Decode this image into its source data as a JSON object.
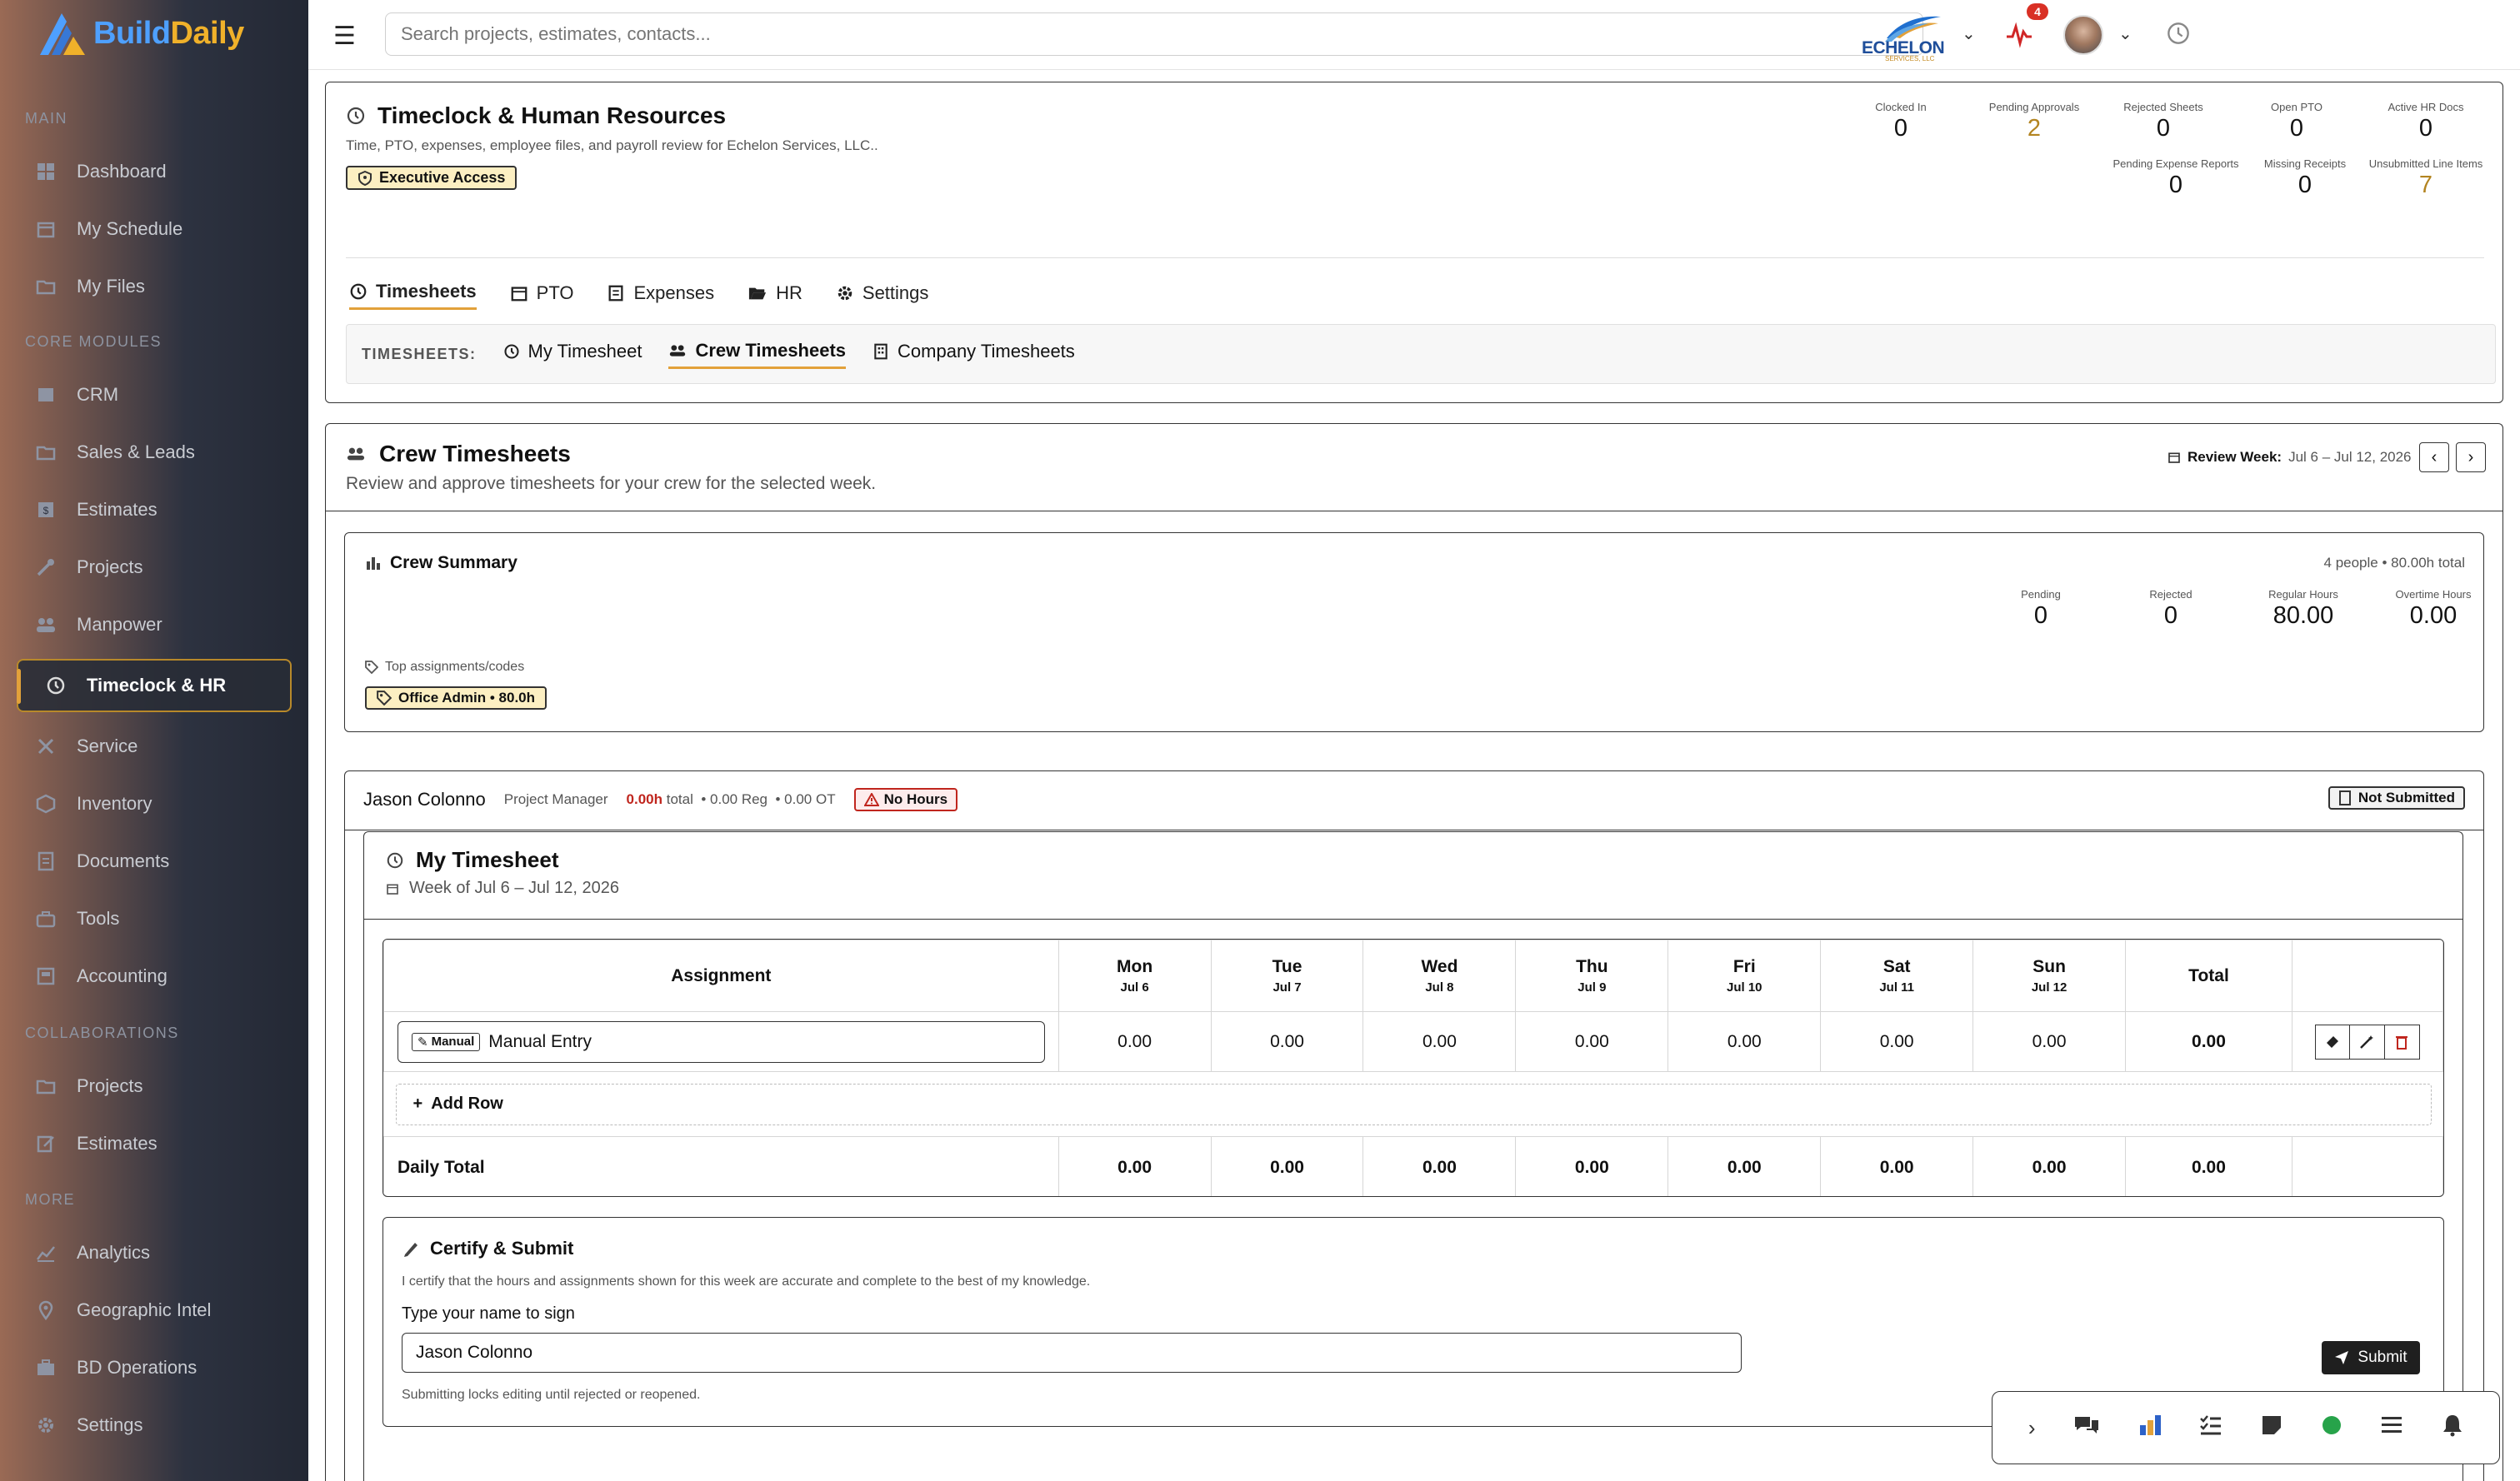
{
  "brand": {
    "part1": "Build",
    "part2": "Daily"
  },
  "sidebar": {
    "sections": [
      "MAIN",
      "CORE MODULES",
      "COLLABORATIONS",
      "MORE"
    ],
    "main": [
      "Dashboard",
      "My Schedule",
      "My Files"
    ],
    "core": [
      "CRM",
      "Sales & Leads",
      "Estimates",
      "Projects",
      "Manpower",
      "Timeclock & HR",
      "Service",
      "Inventory",
      "Documents",
      "Tools",
      "Accounting"
    ],
    "collab": [
      "Projects",
      "Estimates"
    ],
    "more": [
      "Analytics",
      "Geographic Intel",
      "BD Operations",
      "Settings"
    ]
  },
  "topbar": {
    "search_placeholder": "Search projects, estimates, contacts...",
    "company": "ECHELON",
    "company_sub": "SERVICES, LLC",
    "notifications": "4"
  },
  "hr": {
    "title": "Timeclock & Human Resources",
    "subtitle": "Time, PTO, expenses, employee files, and payroll review for Echelon Services, LLC..",
    "access": "Executive Access",
    "stats_row1": [
      {
        "label": "Clocked In",
        "value": "0"
      },
      {
        "label": "Pending Approvals",
        "value": "2"
      },
      {
        "label": "Rejected Sheets",
        "value": "0"
      },
      {
        "label": "Open PTO",
        "value": "0"
      },
      {
        "label": "Active HR Docs",
        "value": "0"
      }
    ],
    "stats_row2": [
      {
        "label": "Pending Expense Reports",
        "value": "0"
      },
      {
        "label": "Missing Receipts",
        "value": "0"
      },
      {
        "label": "Unsubmitted Line Items",
        "value": "7"
      }
    ],
    "tabs": [
      "Timesheets",
      "PTO",
      "Expenses",
      "HR",
      "Settings"
    ],
    "subtabs_label": "TIMESHEETS:",
    "subtabs": [
      "My Timesheet",
      "Crew Timesheets",
      "Company Timesheets"
    ]
  },
  "crew": {
    "title": "Crew Timesheets",
    "subtitle": "Review and approve timesheets for your crew for the selected week.",
    "review_label": "Review Week:",
    "review_range": "Jul 6 – Jul 12, 2026",
    "summary_title": "Crew Summary",
    "summary_meta": "4 people • 80.00h total",
    "summary_stats": [
      {
        "label": "Pending",
        "value": "0"
      },
      {
        "label": "Rejected",
        "value": "0"
      },
      {
        "label": "Regular Hours",
        "value": "80.00"
      },
      {
        "label": "Overtime Hours",
        "value": "0.00"
      }
    ],
    "top_label": "Top assignments/codes",
    "top_chip": "Office Admin • 80.0h"
  },
  "person": {
    "name": "Jason Colonno",
    "role": "Project Manager",
    "total": "0.00h",
    "total_label": "total",
    "reg": "0.00 Reg",
    "ot": "0.00 OT",
    "warn": "No Hours",
    "status": "Not Submitted"
  },
  "timesheet": {
    "title": "My Timesheet",
    "week": "Week of Jul 6 – Jul 12, 2026",
    "assignment_header": "Assignment",
    "total_header": "Total",
    "days": [
      {
        "d": "Mon",
        "date": "Jul 6"
      },
      {
        "d": "Tue",
        "date": "Jul 7"
      },
      {
        "d": "Wed",
        "date": "Jul 8"
      },
      {
        "d": "Thu",
        "date": "Jul 9"
      },
      {
        "d": "Fri",
        "date": "Jul 10"
      },
      {
        "d": "Sat",
        "date": "Jul 11"
      },
      {
        "d": "Sun",
        "date": "Jul 12"
      }
    ],
    "row": {
      "tag": "Manual",
      "name": "Manual Entry",
      "values": [
        "0.00",
        "0.00",
        "0.00",
        "0.00",
        "0.00",
        "0.00",
        "0.00"
      ],
      "total": "0.00"
    },
    "add_row": "Add Row",
    "daily_total_label": "Daily Total",
    "daily_totals": [
      "0.00",
      "0.00",
      "0.00",
      "0.00",
      "0.00",
      "0.00",
      "0.00"
    ],
    "grand_total": "0.00"
  },
  "certify": {
    "title": "Certify & Submit",
    "text": "I certify that the hours and assignments shown for this week are accurate and complete to the best of my knowledge.",
    "sign_label": "Type your name to sign",
    "sign_value": "Jason Colonno",
    "note": "Submitting locks editing until rejected or reopened.",
    "submit": "Submit"
  }
}
